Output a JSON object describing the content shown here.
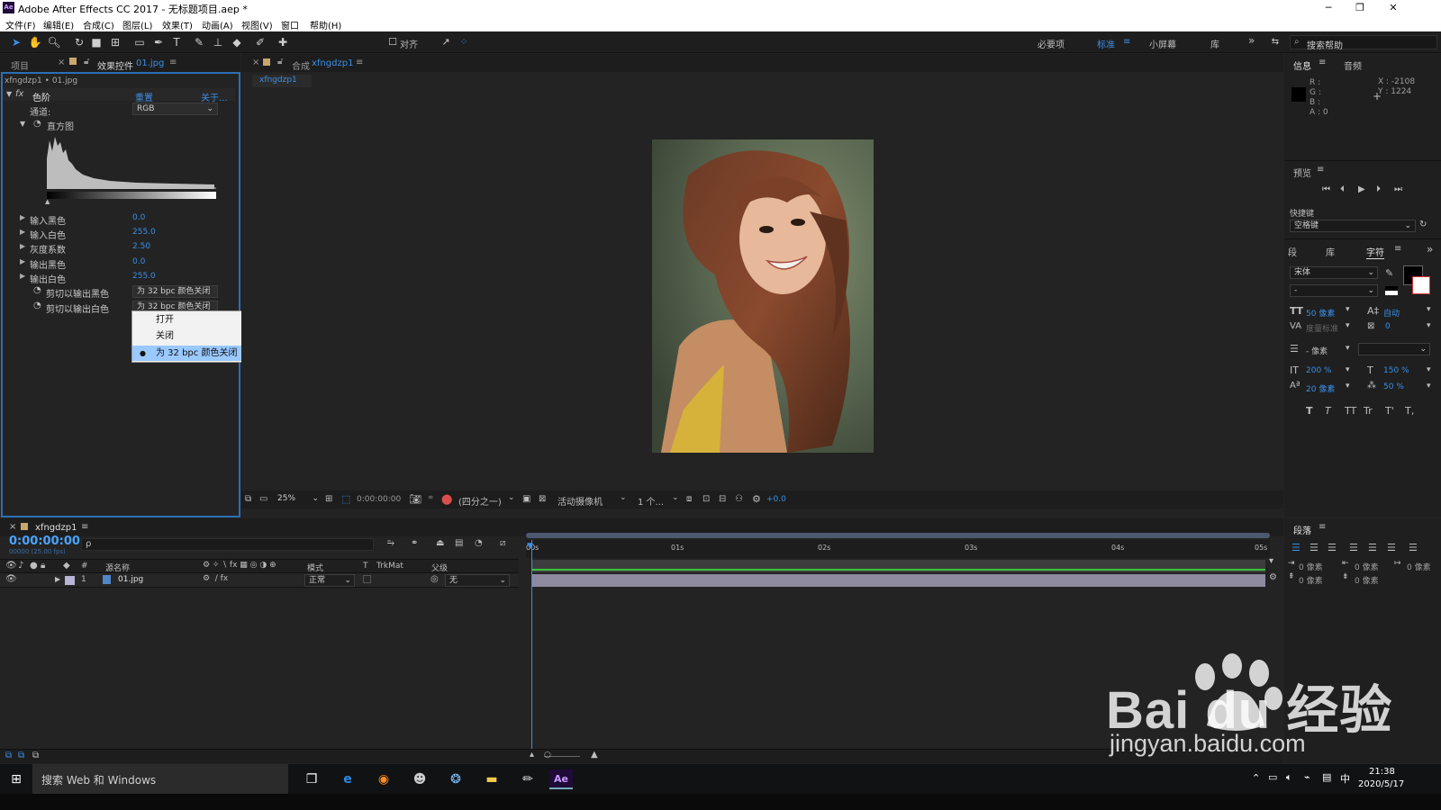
{
  "app": {
    "icon_label": "Ae",
    "title": "Adobe After Effects CC 2017 - 无标题项目.aep *"
  },
  "menu": [
    "文件(F)",
    "编辑(E)",
    "合成(C)",
    "图层(L)",
    "效果(T)",
    "动画(A)",
    "视图(V)",
    "窗口",
    "帮助(H)"
  ],
  "toolbar": {
    "align_label": "对齐",
    "workspaces": [
      "必要项",
      "标准",
      "小屏幕",
      "库"
    ],
    "search_placeholder": "搜索帮助"
  },
  "project_panel": {
    "tab_project": "项目",
    "tab_effects_prefix": "效果控件",
    "tab_effects_file": "01.jpg",
    "breadcrumb": "xfngdzp1 • 01.jpg",
    "effect_name": "色阶",
    "reset": "重置",
    "about": "关于...",
    "channel_label": "通道:",
    "channel_value": "RGB",
    "histogram_label": "直方图",
    "params": [
      {
        "label": "输入黑色",
        "value": "0.0"
      },
      {
        "label": "输入白色",
        "value": "255.0"
      },
      {
        "label": "灰度系数",
        "value": "2.50"
      },
      {
        "label": "输出黑色",
        "value": "0.0"
      },
      {
        "label": "输出白色",
        "value": "255.0"
      }
    ],
    "clip_black_label": "剪切以输出黑色",
    "clip_black_value": "为 32 bpc 颜色关闭",
    "clip_white_label": "剪切以输出白色",
    "clip_white_value": "为 32 bpc 颜色关闭",
    "dropdown_options": [
      "打开",
      "关闭",
      "为 32 bpc 颜色关闭"
    ]
  },
  "comp_panel": {
    "tab_prefix": "合成",
    "tab_name": "xfngdzp1",
    "subtab": "xfngdzp1",
    "zoom": "25%",
    "timecode": "0:00:00:00",
    "resolution": "(四分之一)",
    "camera": "活动摄像机",
    "views": "1 个...",
    "exposure": "+0.0"
  },
  "info_panel": {
    "tab_info": "信息",
    "tab_audio": "音频",
    "r": "R :",
    "g": "G :",
    "b": "B :",
    "a": "A : 0",
    "x": "X : -2108",
    "y": "Y : 1224"
  },
  "preview_panel": {
    "title": "预览",
    "shortcut_label": "快捷键",
    "shortcut_value": "空格键"
  },
  "char_panel": {
    "tab_a": "段",
    "tab_b": "库",
    "tab_c": "字符",
    "font": "宋体",
    "style": "-",
    "size": "50 像素",
    "leading": "自动",
    "kerning": "度量标准",
    "tracking": "0",
    "stroke": "- 像素",
    "vscale": "200 %",
    "hscale": "150 %",
    "baseline": "20 像素",
    "tsume": "50 %",
    "styles": [
      "T",
      "T",
      "TT",
      "Tr",
      "T'",
      "T,"
    ]
  },
  "para_panel": {
    "title": "段落",
    "indent_left": "0 像素",
    "indent_right": "0 像素",
    "indent_first": "0 像素",
    "space_before": "0 像素",
    "space_after": "0 像素"
  },
  "timeline": {
    "tab": "xfngdzp1",
    "timecode": "0:00:00:00",
    "fps": "00000 (25.00 fps)",
    "search_placeholder": "ρ",
    "col_num": "#",
    "col_source": "源名称",
    "col_mode": "模式",
    "col_t": "T",
    "col_trkmat": "TrkMat",
    "col_parent": "父级",
    "layer": {
      "index": "1",
      "name": "01.jpg",
      "mode": "正常",
      "parent": "无"
    },
    "ruler": [
      "00s",
      "01s",
      "02s",
      "03s",
      "04s",
      "05s"
    ]
  },
  "taskbar": {
    "search": "搜索 Web 和 Windows",
    "time": "21:38",
    "date": "2020/5/17",
    "ime": "中"
  },
  "watermark": {
    "brand": "Bai du 经验",
    "url": "jingyan.baidu.com"
  },
  "colors": {
    "accent": "#3a8fe6",
    "timecode": "#4aa3ff",
    "bar_green": "#3cc43c",
    "layer_bar": "#8e8aa0"
  }
}
